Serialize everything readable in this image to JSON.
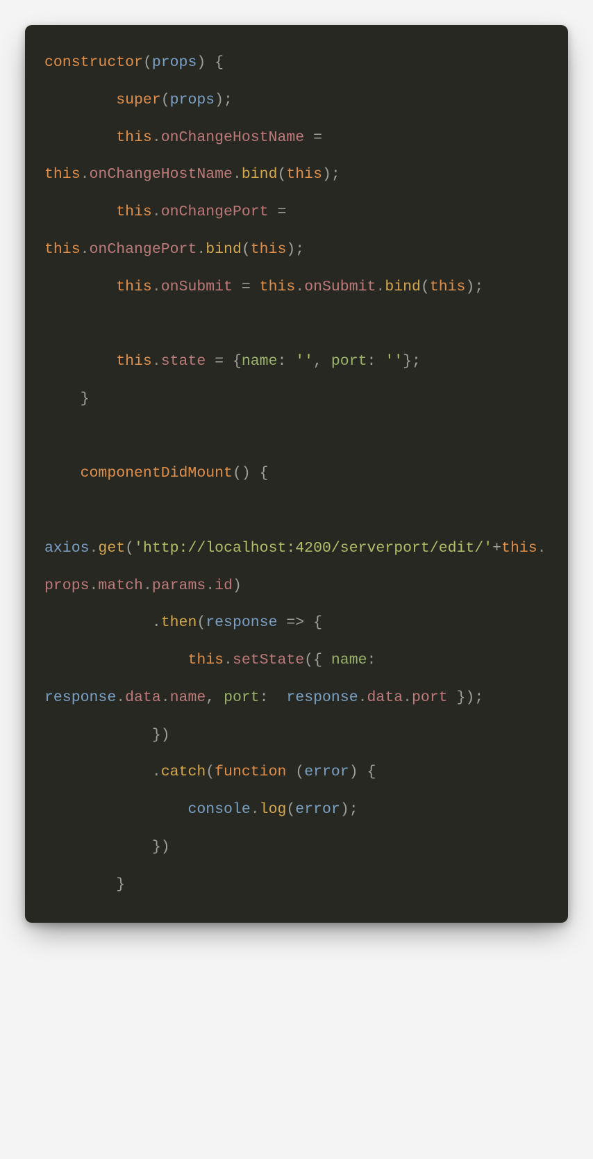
{
  "code": {
    "tokens": [
      [
        {
          "t": "constructor",
          "c": "c-keyword"
        },
        {
          "t": "(",
          "c": "c-punct"
        },
        {
          "t": "props",
          "c": "c-param"
        },
        {
          "t": ") {",
          "c": "c-punct"
        }
      ],
      [
        {
          "t": "        ",
          "c": "c-punct"
        },
        {
          "t": "super",
          "c": "c-keyword"
        },
        {
          "t": "(",
          "c": "c-punct"
        },
        {
          "t": "props",
          "c": "c-param"
        },
        {
          "t": ");",
          "c": "c-punct"
        }
      ],
      [
        {
          "t": "        ",
          "c": "c-punct"
        },
        {
          "t": "this",
          "c": "c-keyword"
        },
        {
          "t": ".",
          "c": "c-dot"
        },
        {
          "t": "onChangeHostName",
          "c": "c-method"
        },
        {
          "t": " = ",
          "c": "c-op"
        },
        {
          "t": "this",
          "c": "c-keyword"
        },
        {
          "t": ".",
          "c": "c-dot"
        },
        {
          "t": "onChangeHostName",
          "c": "c-method"
        },
        {
          "t": ".",
          "c": "c-dot"
        },
        {
          "t": "bind",
          "c": "c-bind"
        },
        {
          "t": "(",
          "c": "c-punct"
        },
        {
          "t": "this",
          "c": "c-keyword"
        },
        {
          "t": ");",
          "c": "c-punct"
        }
      ],
      [
        {
          "t": "        ",
          "c": "c-punct"
        },
        {
          "t": "this",
          "c": "c-keyword"
        },
        {
          "t": ".",
          "c": "c-dot"
        },
        {
          "t": "onChangePort",
          "c": "c-method"
        },
        {
          "t": " = ",
          "c": "c-op"
        },
        {
          "t": "this",
          "c": "c-keyword"
        },
        {
          "t": ".",
          "c": "c-dot"
        },
        {
          "t": "onChangePort",
          "c": "c-method"
        },
        {
          "t": ".",
          "c": "c-dot"
        },
        {
          "t": "bind",
          "c": "c-bind"
        },
        {
          "t": "(",
          "c": "c-punct"
        },
        {
          "t": "this",
          "c": "c-keyword"
        },
        {
          "t": ");",
          "c": "c-punct"
        }
      ],
      [
        {
          "t": "        ",
          "c": "c-punct"
        },
        {
          "t": "this",
          "c": "c-keyword"
        },
        {
          "t": ".",
          "c": "c-dot"
        },
        {
          "t": "onSubmit",
          "c": "c-method"
        },
        {
          "t": " = ",
          "c": "c-op"
        },
        {
          "t": "this",
          "c": "c-keyword"
        },
        {
          "t": ".",
          "c": "c-dot"
        },
        {
          "t": "onSubmit",
          "c": "c-method"
        },
        {
          "t": ".",
          "c": "c-dot"
        },
        {
          "t": "bind",
          "c": "c-bind"
        },
        {
          "t": "(",
          "c": "c-punct"
        },
        {
          "t": "this",
          "c": "c-keyword"
        },
        {
          "t": ");",
          "c": "c-punct"
        }
      ],
      [
        {
          "t": "",
          "c": "c-punct"
        }
      ],
      [
        {
          "t": "        ",
          "c": "c-punct"
        },
        {
          "t": "this",
          "c": "c-keyword"
        },
        {
          "t": ".",
          "c": "c-dot"
        },
        {
          "t": "state",
          "c": "c-method"
        },
        {
          "t": " = {",
          "c": "c-punct"
        },
        {
          "t": "name",
          "c": "c-prop"
        },
        {
          "t": ": ",
          "c": "c-punct"
        },
        {
          "t": "''",
          "c": "c-string"
        },
        {
          "t": ", ",
          "c": "c-punct"
        },
        {
          "t": "port",
          "c": "c-prop"
        },
        {
          "t": ": ",
          "c": "c-punct"
        },
        {
          "t": "''",
          "c": "c-string"
        },
        {
          "t": "};",
          "c": "c-punct"
        }
      ],
      [
        {
          "t": "    }",
          "c": "c-punct"
        }
      ],
      [
        {
          "t": "",
          "c": "c-punct"
        }
      ],
      [
        {
          "t": "    ",
          "c": "c-punct"
        },
        {
          "t": "componentDidMount",
          "c": "c-keyword"
        },
        {
          "t": "() {",
          "c": "c-punct"
        }
      ],
      [
        {
          "t": "        ",
          "c": "c-punct"
        },
        {
          "t": "axios",
          "c": "c-param"
        },
        {
          "t": ".",
          "c": "c-dot"
        },
        {
          "t": "get",
          "c": "c-bind"
        },
        {
          "t": "(",
          "c": "c-punct"
        },
        {
          "t": "'http://localhost:4200/serverport/edit/'",
          "c": "c-string"
        },
        {
          "t": "+",
          "c": "c-op"
        },
        {
          "t": "this",
          "c": "c-keyword"
        },
        {
          "t": ".",
          "c": "c-dot"
        },
        {
          "t": "props",
          "c": "c-method"
        },
        {
          "t": ".",
          "c": "c-dot"
        },
        {
          "t": "match",
          "c": "c-method"
        },
        {
          "t": ".",
          "c": "c-dot"
        },
        {
          "t": "params",
          "c": "c-method"
        },
        {
          "t": ".",
          "c": "c-dot"
        },
        {
          "t": "id",
          "c": "c-method"
        },
        {
          "t": ")",
          "c": "c-punct"
        }
      ],
      [
        {
          "t": "            .",
          "c": "c-punct"
        },
        {
          "t": "then",
          "c": "c-bind"
        },
        {
          "t": "(",
          "c": "c-punct"
        },
        {
          "t": "response",
          "c": "c-param"
        },
        {
          "t": " => {",
          "c": "c-arrow"
        }
      ],
      [
        {
          "t": "                ",
          "c": "c-punct"
        },
        {
          "t": "this",
          "c": "c-keyword"
        },
        {
          "t": ".",
          "c": "c-dot"
        },
        {
          "t": "setState",
          "c": "c-method"
        },
        {
          "t": "({ ",
          "c": "c-punct"
        },
        {
          "t": "name",
          "c": "c-prop"
        },
        {
          "t": ": ",
          "c": "c-punct"
        },
        {
          "t": " response",
          "c": "c-param"
        },
        {
          "t": ".",
          "c": "c-dot"
        },
        {
          "t": "data",
          "c": "c-method"
        },
        {
          "t": ".",
          "c": "c-dot"
        },
        {
          "t": "name",
          "c": "c-method"
        },
        {
          "t": ", ",
          "c": "c-punct"
        },
        {
          "t": "port",
          "c": "c-prop"
        },
        {
          "t": ": ",
          "c": "c-punct"
        },
        {
          "t": " response",
          "c": "c-param"
        },
        {
          "t": ".",
          "c": "c-dot"
        },
        {
          "t": "data",
          "c": "c-method"
        },
        {
          "t": ".",
          "c": "c-dot"
        },
        {
          "t": "port",
          "c": "c-method"
        },
        {
          "t": " });",
          "c": "c-punct"
        }
      ],
      [
        {
          "t": "            })",
          "c": "c-punct"
        }
      ],
      [
        {
          "t": "            .",
          "c": "c-punct"
        },
        {
          "t": "catch",
          "c": "c-bind"
        },
        {
          "t": "(",
          "c": "c-punct"
        },
        {
          "t": "function",
          "c": "c-keyword"
        },
        {
          "t": " (",
          "c": "c-punct"
        },
        {
          "t": "error",
          "c": "c-param"
        },
        {
          "t": ") {",
          "c": "c-punct"
        }
      ],
      [
        {
          "t": "                ",
          "c": "c-punct"
        },
        {
          "t": "console",
          "c": "c-param"
        },
        {
          "t": ".",
          "c": "c-dot"
        },
        {
          "t": "log",
          "c": "c-bind"
        },
        {
          "t": "(",
          "c": "c-punct"
        },
        {
          "t": "error",
          "c": "c-param"
        },
        {
          "t": ");",
          "c": "c-punct"
        }
      ],
      [
        {
          "t": "            })",
          "c": "c-punct"
        }
      ],
      [
        {
          "t": "        }",
          "c": "c-punct"
        }
      ]
    ]
  }
}
